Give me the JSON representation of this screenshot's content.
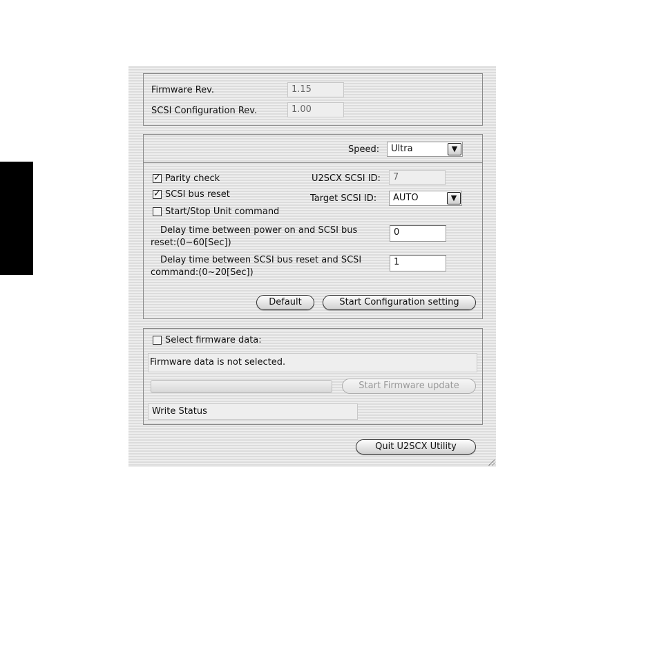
{
  "info": {
    "firmware_rev_label": "Firmware Rev.",
    "firmware_rev_value": "1.15",
    "scsi_config_rev_label": "SCSI Configuration Rev.",
    "scsi_config_rev_value": "1.00"
  },
  "config": {
    "speed_label": "Speed:",
    "speed_value": "Ultra",
    "parity_check_label": "Parity check",
    "parity_check_checked": true,
    "scsi_bus_reset_label": "SCSI bus reset",
    "scsi_bus_reset_checked": true,
    "start_stop_label": "Start/Stop Unit command",
    "start_stop_checked": false,
    "u2scx_id_label": "U2SCX SCSI ID:",
    "u2scx_id_value": "7",
    "target_id_label": "Target SCSI ID:",
    "target_id_value": "AUTO",
    "delay1_line1": "Delay time between power on and SCSI bus",
    "delay1_line2": "reset:(0~60[Sec])",
    "delay1_value": "0",
    "delay2_line1": "Delay time between SCSI bus reset and SCSI",
    "delay2_line2": "command:(0~20[Sec])",
    "delay2_value": "1",
    "default_button": "Default",
    "start_config_button": "Start Configuration setting"
  },
  "firmware": {
    "select_label": "Select firmware data:",
    "select_checked": false,
    "status_text": "Firmware data is not selected.",
    "progress": 0,
    "start_update_button": "Start Firmware update",
    "write_status": "Write Status"
  },
  "quit_button": "Quit U2SCX Utility",
  "icons": {
    "dropdown_arrow": "▼",
    "checkmark": "✓"
  }
}
